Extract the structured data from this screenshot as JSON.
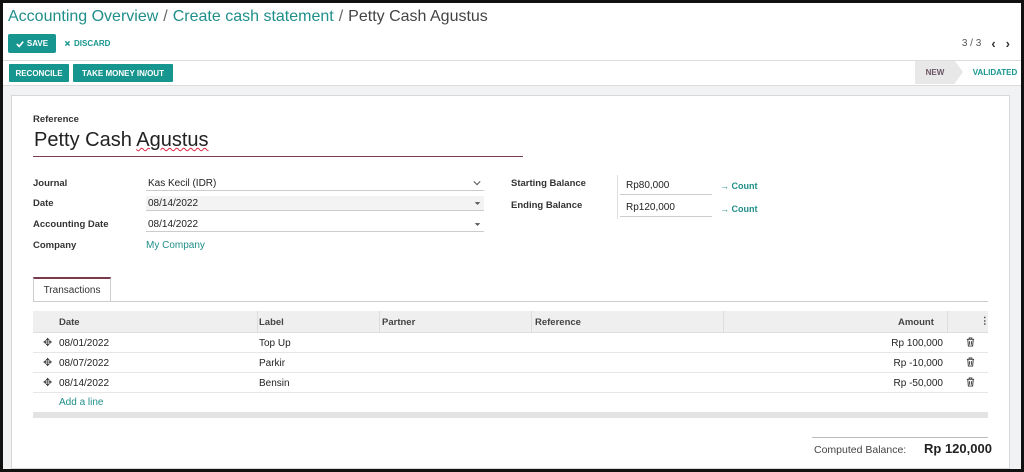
{
  "breadcrumb": {
    "items": [
      "Accounting Overview",
      "Create cash statement"
    ],
    "separator": "/",
    "current": "Petty Cash Agustus"
  },
  "toolbar": {
    "save_label": "SAVE",
    "discard_label": "DISCARD"
  },
  "pager": {
    "text": "3 / 3",
    "prev_icon": "‹",
    "next_icon": "›"
  },
  "actions": {
    "reconcile": "RECONCILE",
    "take_money": "TAKE MONEY IN/OUT"
  },
  "status": {
    "new": "NEW",
    "validated": "VALIDATED"
  },
  "form": {
    "reference_label": "Reference",
    "reference_value_pre": "Petty Cash ",
    "reference_value_sq": "Agustus",
    "journal_label": "Journal",
    "journal_value": "Kas Kecil (IDR)",
    "date_label": "Date",
    "date_value": "08/14/2022",
    "accounting_date_label": "Accounting Date",
    "accounting_date_value": "08/14/2022",
    "company_label": "Company",
    "company_value": "My Company",
    "starting_balance_label": "Starting Balance",
    "starting_balance_value": "Rp80,000",
    "ending_balance_label": "Ending Balance",
    "ending_balance_value": "Rp120,000",
    "count_label": "→ Count"
  },
  "tabs": [
    {
      "label": "Transactions"
    }
  ],
  "table": {
    "columns": [
      "Date",
      "Label",
      "Partner",
      "Reference",
      "Amount"
    ],
    "rows": [
      {
        "date": "08/01/2022",
        "label": "Top Up",
        "partner": "",
        "reference": "",
        "amount": "Rp 100,000"
      },
      {
        "date": "08/07/2022",
        "label": "Parkir",
        "partner": "",
        "reference": "",
        "amount": "Rp -10,000"
      },
      {
        "date": "08/14/2022",
        "label": "Bensin",
        "partner": "",
        "reference": "",
        "amount": "Rp -50,000"
      }
    ],
    "add_line": "Add a line",
    "handle_icon": "✥",
    "col_options_icon": "⋮"
  },
  "footer": {
    "computed_balance_label": "Computed Balance:",
    "computed_balance_value": "Rp 120,000"
  },
  "colors": {
    "primary": "#17968f",
    "accent": "#7a3b4d"
  }
}
